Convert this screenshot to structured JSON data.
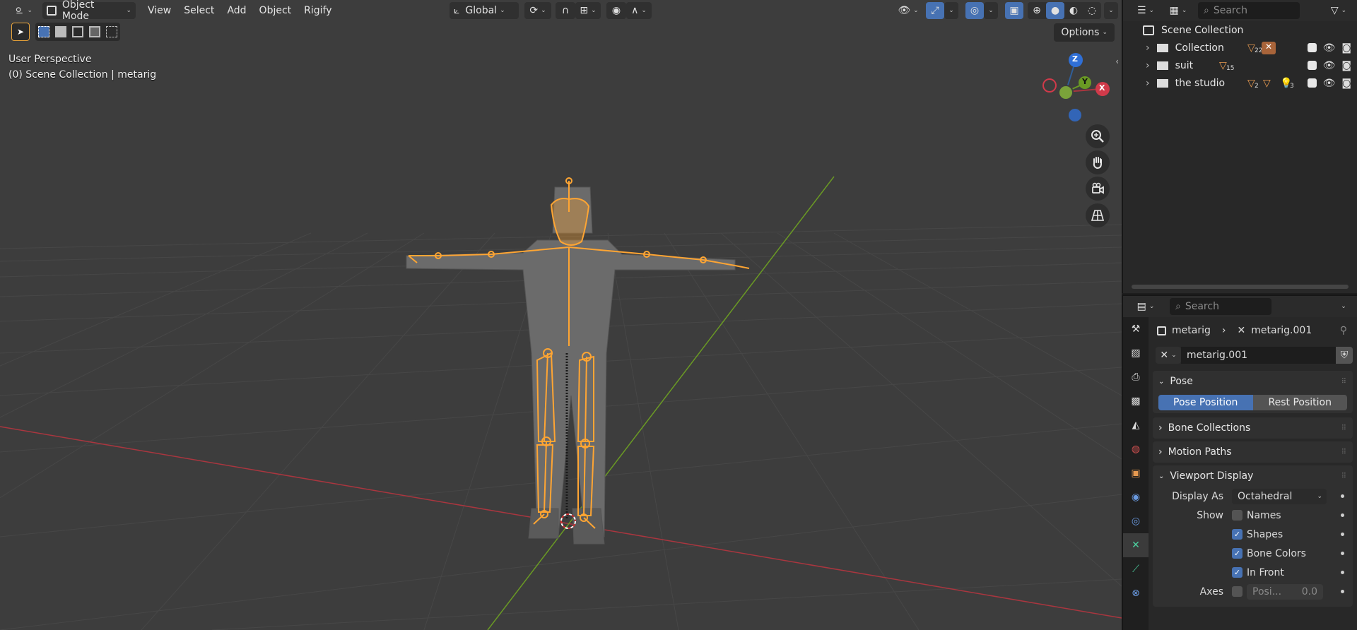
{
  "header": {
    "mode": "Object Mode",
    "menus": [
      "View",
      "Select",
      "Add",
      "Object",
      "Rigify"
    ],
    "transform_orientation": "Global",
    "options_label": "Options"
  },
  "viewport": {
    "view_name": "User Perspective",
    "collection_info": "(0) Scene Collection | metarig",
    "gizmo_axes": {
      "z": "Z",
      "y": "Y",
      "x": "X"
    }
  },
  "outliner": {
    "search_placeholder": "Search",
    "root": "Scene Collection",
    "items": [
      {
        "label": "Collection",
        "badge": "22"
      },
      {
        "label": "suit",
        "badge": "15"
      },
      {
        "label": "the studio",
        "badge_a": "2",
        "badge_b": "3"
      }
    ]
  },
  "properties": {
    "search_placeholder": "Search",
    "breadcrumb": {
      "object": "metarig",
      "data": "metarig.001"
    },
    "datablock_name": "metarig.001",
    "sections": {
      "pose": "Pose",
      "bone_collections": "Bone Collections",
      "motion_paths": "Motion Paths",
      "viewport_display": "Viewport Display"
    },
    "pose_position": "Pose Position",
    "rest_position": "Rest Position",
    "display_as_label": "Display As",
    "display_as_value": "Octahedral",
    "show_label": "Show",
    "show_options": [
      {
        "label": "Names",
        "checked": false
      },
      {
        "label": "Shapes",
        "checked": true
      },
      {
        "label": "Bone Colors",
        "checked": true
      },
      {
        "label": "In Front",
        "checked": true
      }
    ],
    "axes_label": "Axes",
    "axes_position_label": "Posi...",
    "axes_position_value": "0.0"
  },
  "colors": {
    "accent": "#4772b3",
    "bone": "#ffa533",
    "x_axis": "#a9363f",
    "y_axis": "#6a9a24"
  }
}
